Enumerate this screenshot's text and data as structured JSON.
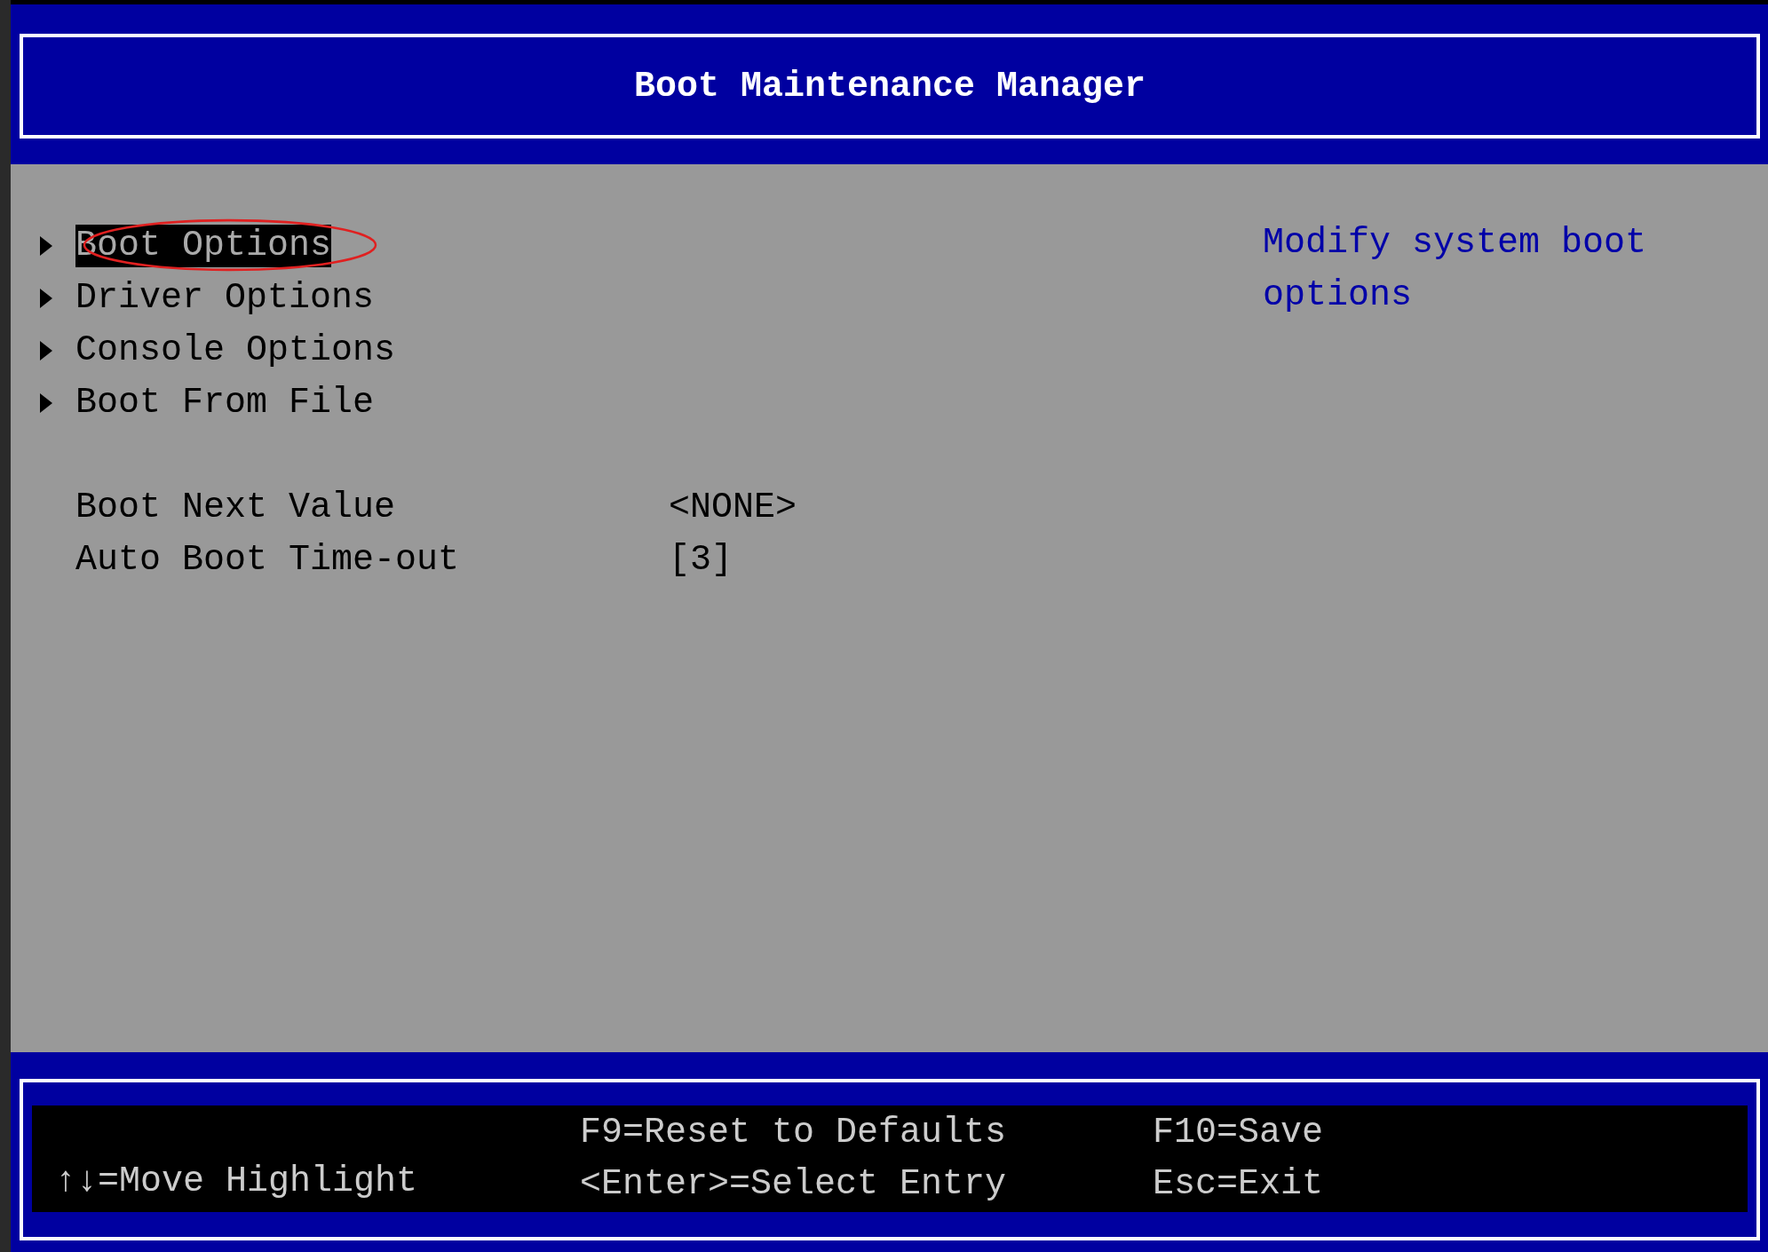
{
  "header": {
    "title": "Boot Maintenance Manager"
  },
  "menu": [
    {
      "label": "Boot Options",
      "selected": true,
      "circled": true
    },
    {
      "label": "Driver Options",
      "selected": false,
      "circled": false
    },
    {
      "label": "Console Options",
      "selected": false,
      "circled": false
    },
    {
      "label": "Boot From File",
      "selected": false,
      "circled": false
    }
  ],
  "settings": [
    {
      "label": "Boot Next Value",
      "value": "<NONE>"
    },
    {
      "label": "Auto Boot Time-out",
      "value": "[3]"
    }
  ],
  "help_text": "Modify system boot options",
  "footer": [
    {
      "bottom": "↑↓=Move Highlight"
    },
    {
      "top": "F9=Reset to Defaults",
      "bottom": "<Enter>=Select Entry"
    },
    {
      "top": "F10=Save",
      "bottom": "Esc=Exit"
    }
  ]
}
